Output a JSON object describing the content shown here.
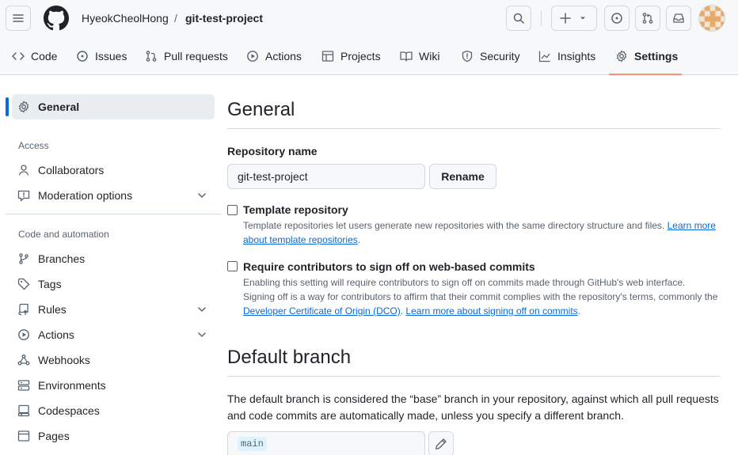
{
  "header": {
    "owner": "HyeokCheolHong",
    "separator": "/",
    "repo": "git-test-project",
    "icons": [
      "menu-icon",
      "github-logo",
      "search-icon",
      "plus-icon",
      "triangle-down-icon",
      "issue-icon",
      "pull-request-icon",
      "inbox-icon",
      "avatar"
    ]
  },
  "nav": {
    "tabs": [
      {
        "label": "Code",
        "icon": "code-icon"
      },
      {
        "label": "Issues",
        "icon": "issue-icon"
      },
      {
        "label": "Pull requests",
        "icon": "pull-request-icon"
      },
      {
        "label": "Actions",
        "icon": "play-icon"
      },
      {
        "label": "Projects",
        "icon": "table-icon"
      },
      {
        "label": "Wiki",
        "icon": "book-icon"
      },
      {
        "label": "Security",
        "icon": "shield-icon"
      },
      {
        "label": "Insights",
        "icon": "graph-icon"
      },
      {
        "label": "Settings",
        "icon": "gear-icon"
      }
    ],
    "active": "Settings"
  },
  "sidebar": {
    "general": "General",
    "access_heading": "Access",
    "access_items": [
      {
        "label": "Collaborators",
        "icon": "person-icon"
      },
      {
        "label": "Moderation options",
        "icon": "report-icon",
        "expandable": true
      }
    ],
    "automation_heading": "Code and automation",
    "automation_items": [
      {
        "label": "Branches",
        "icon": "branch-icon"
      },
      {
        "label": "Tags",
        "icon": "tag-icon"
      },
      {
        "label": "Rules",
        "icon": "repo-push-icon",
        "expandable": true
      },
      {
        "label": "Actions",
        "icon": "play-icon",
        "expandable": true
      },
      {
        "label": "Webhooks",
        "icon": "webhook-icon"
      },
      {
        "label": "Environments",
        "icon": "server-icon"
      },
      {
        "label": "Codespaces",
        "icon": "codespaces-icon"
      },
      {
        "label": "Pages",
        "icon": "browser-icon"
      }
    ]
  },
  "main": {
    "title": "General",
    "repo_name_label": "Repository name",
    "repo_name_value": "git-test-project",
    "rename_label": "Rename",
    "template": {
      "title": "Template repository",
      "desc": "Template repositories let users generate new repositories with the same directory structure and files.",
      "link": "Learn more about template repositories",
      "end": "."
    },
    "signoff": {
      "title": "Require contributors to sign off on web-based commits",
      "desc": "Enabling this setting will require contributors to sign off on commits made through GitHub's web interface. Signing off is a way for contributors to affirm that their commit complies with the repository's terms, commonly the",
      "link1": "Developer Certificate of Origin (DCO)",
      "mid": ".",
      "link2": "Learn more about signing off on commits",
      "end": "."
    },
    "default_branch_title": "Default branch",
    "default_branch_desc": "The default branch is considered the “base” branch in your repository, against which all pull requests and code commits are automatically made, unless you specify a different branch.",
    "default_branch_value": "main"
  },
  "colors": {
    "accent": "#0969da",
    "tab_underline": "#fd8c73",
    "header_bg": "#f6f8fa",
    "border": "#d1d9e0",
    "muted": "#59636e"
  }
}
